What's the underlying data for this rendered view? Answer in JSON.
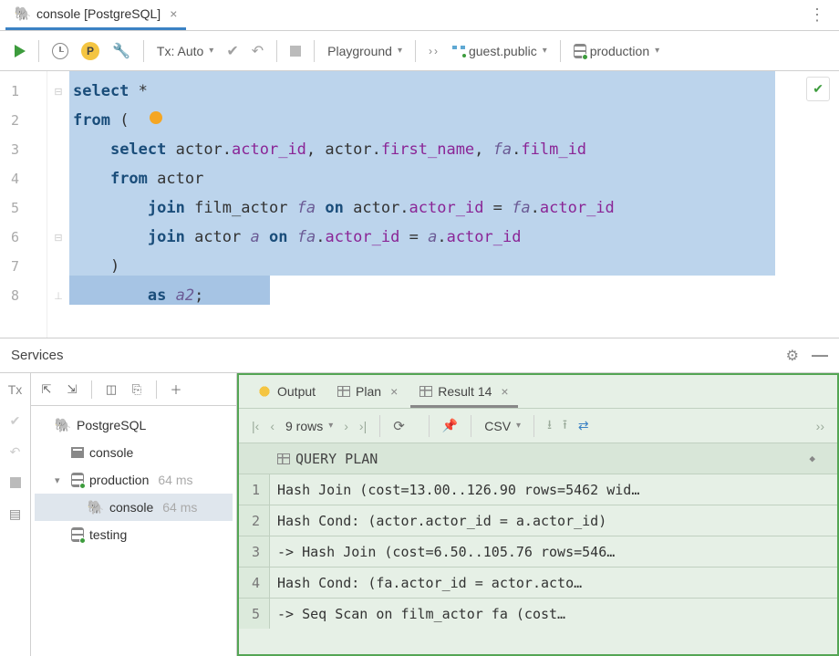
{
  "tab": {
    "title": "console [PostgreSQL]"
  },
  "toolbar": {
    "tx_label": "Tx: Auto",
    "playground_label": "Playground",
    "schema_label": "guest.public",
    "datasource_label": "production"
  },
  "editor": {
    "lines": [
      {
        "n": "1",
        "pre": "",
        "tokens": [
          {
            "t": "select",
            "c": "kw"
          },
          {
            "t": " ",
            "c": ""
          },
          {
            "t": "*",
            "c": "paren"
          }
        ]
      },
      {
        "n": "2",
        "pre": "",
        "tokens": [
          {
            "t": "from",
            "c": "kw"
          },
          {
            "t": " (",
            "c": "paren"
          }
        ]
      },
      {
        "n": "3",
        "pre": "    ",
        "tokens": [
          {
            "t": "select",
            "c": "kw"
          },
          {
            "t": " actor.",
            "c": ""
          },
          {
            "t": "actor_id",
            "c": "col"
          },
          {
            "t": ", actor.",
            "c": ""
          },
          {
            "t": "first_name",
            "c": "col"
          },
          {
            "t": ", ",
            "c": ""
          },
          {
            "t": "fa",
            "c": "pkg"
          },
          {
            "t": ".",
            "c": ""
          },
          {
            "t": "film_id",
            "c": "col"
          }
        ]
      },
      {
        "n": "4",
        "pre": "    ",
        "tokens": [
          {
            "t": "from",
            "c": "kw"
          },
          {
            "t": " actor",
            "c": ""
          }
        ]
      },
      {
        "n": "5",
        "pre": "        ",
        "tokens": [
          {
            "t": "join",
            "c": "kw"
          },
          {
            "t": " film_actor ",
            "c": ""
          },
          {
            "t": "fa",
            "c": "pkg"
          },
          {
            "t": " ",
            "c": ""
          },
          {
            "t": "on",
            "c": "kw"
          },
          {
            "t": " actor.",
            "c": ""
          },
          {
            "t": "actor_id",
            "c": "col"
          },
          {
            "t": " = ",
            "c": ""
          },
          {
            "t": "fa",
            "c": "pkg"
          },
          {
            "t": ".",
            "c": ""
          },
          {
            "t": "actor_id",
            "c": "col"
          }
        ]
      },
      {
        "n": "6",
        "pre": "        ",
        "tokens": [
          {
            "t": "join",
            "c": "kw"
          },
          {
            "t": " actor ",
            "c": ""
          },
          {
            "t": "a",
            "c": "pkg"
          },
          {
            "t": " ",
            "c": ""
          },
          {
            "t": "on",
            "c": "kw"
          },
          {
            "t": " ",
            "c": ""
          },
          {
            "t": "fa",
            "c": "pkg"
          },
          {
            "t": ".",
            "c": ""
          },
          {
            "t": "actor_id",
            "c": "col"
          },
          {
            "t": " = ",
            "c": ""
          },
          {
            "t": "a",
            "c": "pkg"
          },
          {
            "t": ".",
            "c": ""
          },
          {
            "t": "actor_id",
            "c": "col"
          }
        ]
      },
      {
        "n": "7",
        "pre": "    ",
        "tokens": [
          {
            "t": ")",
            "c": "paren"
          }
        ]
      },
      {
        "n": "8",
        "pre": "        ",
        "tokens": [
          {
            "t": "as",
            "c": "kw"
          },
          {
            "t": " ",
            "c": ""
          },
          {
            "t": "a2",
            "c": "pkg"
          },
          {
            "t": ";",
            "c": "paren"
          }
        ]
      }
    ]
  },
  "services": {
    "title": "Services",
    "tx_label": "Tx",
    "tree": [
      {
        "level": 0,
        "icon": "pg",
        "label": "PostgreSQL",
        "time": "",
        "arrow": "",
        "selected": false
      },
      {
        "level": 1,
        "icon": "cons",
        "label": "console",
        "time": "",
        "arrow": "",
        "selected": false
      },
      {
        "level": 1,
        "icon": "db",
        "label": "production",
        "time": "64 ms",
        "arrow": "▾",
        "selected": false
      },
      {
        "level": 2,
        "icon": "pg",
        "label": "console",
        "time": "64 ms",
        "arrow": "",
        "selected": true
      },
      {
        "level": 1,
        "icon": "db",
        "label": "testing",
        "time": "",
        "arrow": "",
        "selected": false
      }
    ]
  },
  "results": {
    "tabs": {
      "output": "Output",
      "plan": "Plan",
      "result": "Result 14"
    },
    "rows_label": "9 rows",
    "csv_label": "CSV",
    "header": "QUERY PLAN",
    "rows": [
      {
        "n": "1",
        "txt": "Hash Join  (cost=13.00..126.90 rows=5462 wid…"
      },
      {
        "n": "2",
        "txt": "  Hash Cond: (actor.actor_id = a.actor_id)"
      },
      {
        "n": "3",
        "txt": "  ->  Hash Join  (cost=6.50..105.76 rows=546…"
      },
      {
        "n": "4",
        "txt": "        Hash Cond: (fa.actor_id = actor.acto…"
      },
      {
        "n": "5",
        "txt": "        ->  Seq Scan on film_actor fa  (cost…"
      }
    ]
  }
}
